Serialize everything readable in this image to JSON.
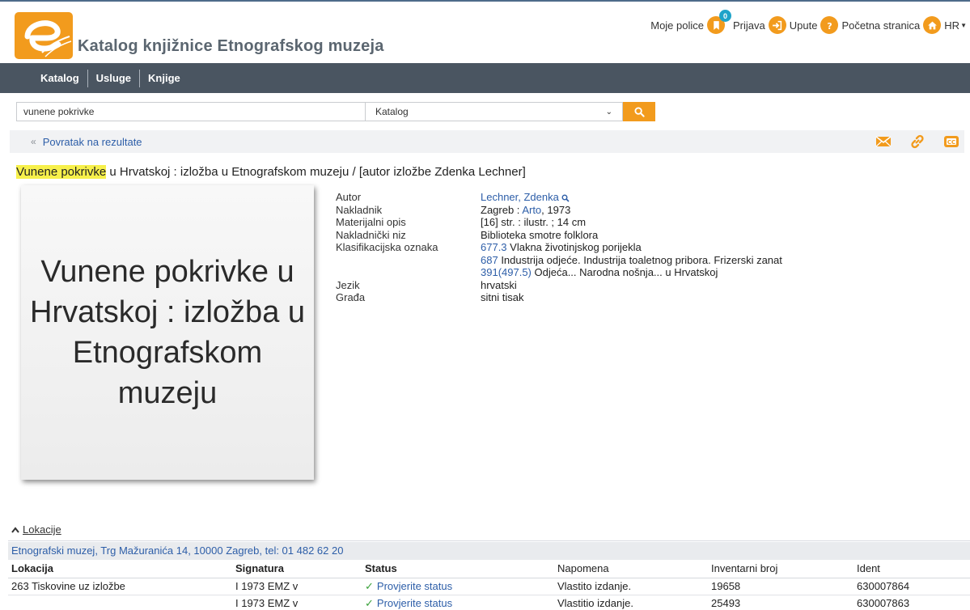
{
  "header": {
    "site_title": "Katalog knjižnice Etnografskog muzeja",
    "links": {
      "shelves": "Moje police",
      "shelves_count": "0",
      "login": "Prijava",
      "help": "Upute",
      "home": "Početna stranica",
      "lang": "HR"
    }
  },
  "nav": {
    "items": [
      "Katalog",
      "Usluge",
      "Knjige"
    ]
  },
  "search": {
    "query": "vunene pokrivke",
    "scope": "Katalog"
  },
  "back": {
    "label": "Povratak na rezultate"
  },
  "record": {
    "title_highlight": "Vunene pokrivke",
    "title_rest": " u Hrvatskoj : izložba u Etnografskom muzeju / [autor izložbe Zdenka Lechner]",
    "cover_text": "Vunene pokrivke u Hrvatskoj : izložba u Etnografskom muzeju",
    "labels": {
      "author": "Autor",
      "publisher": "Nakladnik",
      "physical": "Materijalni opis",
      "series": "Nakladnički niz",
      "classification": "Klasifikacijska oznaka",
      "language": "Jezik",
      "material": "Građa"
    },
    "author": "Lechner, Zdenka",
    "publisher_place": "Zagreb : ",
    "publisher_name": "Arto",
    "publisher_year": ", 1973",
    "physical": "[16] str. : ilustr. ; 14 cm",
    "series": "Biblioteka smotre folklora",
    "classifications": [
      {
        "code": "677.3",
        "text": " Vlakna životinjskog porijekla"
      },
      {
        "code": "687",
        "text": " Industrija odjeće. Industrija toaletnog pribora. Frizerski zanat"
      },
      {
        "code": "391(497.5)",
        "text": " Odjeća... Narodna nošnja... u Hrvatskoj"
      }
    ],
    "language": "hrvatski",
    "material": "sitni tisak"
  },
  "locations": {
    "toggle_label": "Lokacije",
    "address": "Etnografski muzej, Trg Mažuranića 14, 10000 Zagreb, tel: 01 482 62 20",
    "columns": [
      "Lokacija",
      "Signatura",
      "Status",
      "Napomena",
      "Inventarni broj",
      "Ident"
    ],
    "rows": [
      {
        "lokacija": "263 Tiskovine uz izložbe",
        "signatura": "I 1973 EMZ v",
        "status": "Provjerite status",
        "napomena": "Vlastito izdanje.",
        "inventarni": "19658",
        "ident": "630007864"
      },
      {
        "lokacija": "",
        "signatura": "I 1973 EMZ v",
        "status": "Provjerite status",
        "napomena": "Vlastitio izdanje.",
        "inventarni": "25493",
        "ident": "630007863"
      }
    ]
  },
  "colors": {
    "accent": "#f29b1d",
    "navbar": "#4a5561",
    "link": "#2d5ea8",
    "highlight": "#f7f04b"
  }
}
